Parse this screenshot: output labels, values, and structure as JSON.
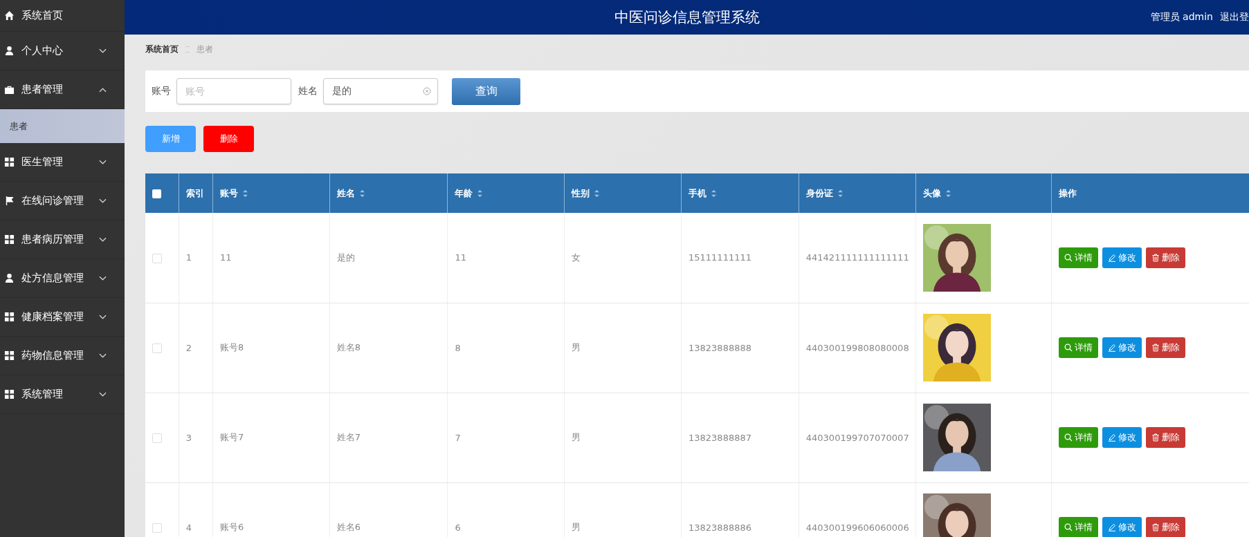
{
  "sidebar": {
    "items": [
      {
        "label": "系统首页",
        "kind": "link"
      },
      {
        "label": "个人中心",
        "kind": "menu",
        "expanded": false
      },
      {
        "label": "患者管理",
        "kind": "menu",
        "expanded": true,
        "children": [
          {
            "label": "患者",
            "selected": true
          }
        ]
      },
      {
        "label": "医生管理",
        "kind": "menu",
        "expanded": false
      },
      {
        "label": "在线问诊管理",
        "kind": "menu",
        "expanded": false
      },
      {
        "label": "患者病历管理",
        "kind": "menu",
        "expanded": false
      },
      {
        "label": "处方信息管理",
        "kind": "menu",
        "expanded": false
      },
      {
        "label": "健康档案管理",
        "kind": "menu",
        "expanded": false
      },
      {
        "label": "药物信息管理",
        "kind": "menu",
        "expanded": false
      },
      {
        "label": "系统管理",
        "kind": "menu",
        "expanded": false
      }
    ]
  },
  "header": {
    "title": "中医问诊信息管理系统",
    "user": "管理员 admin",
    "logout": "退出登"
  },
  "breadcrumb": [
    "系统首页",
    "患者"
  ],
  "search": {
    "fields": [
      {
        "label": "账号",
        "placeholder": "账号"
      },
      {
        "label": "姓名",
        "value": "是的"
      }
    ],
    "button": "查询"
  },
  "actions": [
    {
      "label": "新增",
      "kind": "add"
    },
    {
      "label": "删除",
      "kind": "delete"
    }
  ],
  "table": {
    "select_all": false,
    "columns": [
      {
        "label": "索引",
        "sortable": false
      },
      {
        "label": "账号",
        "sortable": true
      },
      {
        "label": "姓名",
        "sortable": true
      },
      {
        "label": "年龄",
        "sortable": true
      },
      {
        "label": "性别",
        "sortable": true
      },
      {
        "label": "手机",
        "sortable": true
      },
      {
        "label": "身份证",
        "sortable": true
      },
      {
        "label": "头像",
        "sortable": true
      },
      {
        "label": "操作",
        "sortable": false
      }
    ],
    "rows": [
      {
        "checked": false,
        "cells": [
          "1",
          "11",
          "是的",
          "11",
          "女",
          "15111111111",
          "441421111111111111"
        ],
        "avatar": {
          "kind": "picture"
        },
        "actions": [
          {
            "label": "详情",
            "kind": "detail"
          },
          {
            "label": "修改",
            "kind": "edit"
          },
          {
            "label": "删除",
            "kind": "delete"
          }
        ]
      },
      {
        "checked": false,
        "cells": [
          "2",
          "账号8",
          "姓名8",
          "8",
          "男",
          "13823888888",
          "440300199808080008"
        ],
        "avatar": {
          "kind": "picture"
        },
        "actions": [
          {
            "label": "详情",
            "kind": "detail"
          },
          {
            "label": "修改",
            "kind": "edit"
          },
          {
            "label": "删除",
            "kind": "delete"
          }
        ]
      },
      {
        "checked": false,
        "cells": [
          "3",
          "账号7",
          "姓名7",
          "7",
          "男",
          "13823888887",
          "440300199707070007"
        ],
        "avatar": {
          "kind": "picture"
        },
        "actions": [
          {
            "label": "详情",
            "kind": "detail"
          },
          {
            "label": "修改",
            "kind": "edit"
          },
          {
            "label": "删除",
            "kind": "delete"
          }
        ]
      },
      {
        "checked": false,
        "cells": [
          "4",
          "账号6",
          "姓名6",
          "6",
          "男",
          "13823888886",
          "440300199606060006"
        ],
        "avatar": {
          "kind": "picture"
        },
        "actions": [
          {
            "label": "详情",
            "kind": "detail"
          },
          {
            "label": "修改",
            "kind": "edit"
          },
          {
            "label": "删除",
            "kind": "delete"
          }
        ]
      }
    ]
  }
}
